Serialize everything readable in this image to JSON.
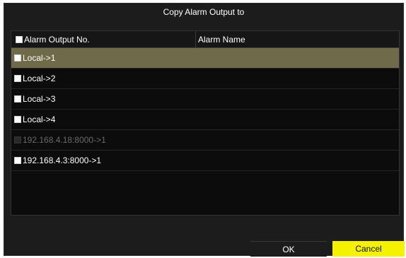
{
  "dialog": {
    "title": "Copy Alarm Output to"
  },
  "table": {
    "headers": {
      "col1": "Alarm Output No.",
      "col2": "Alarm Name"
    },
    "rows": [
      {
        "label": "Local->1",
        "selected": true,
        "enabled": true
      },
      {
        "label": "Local->2",
        "selected": false,
        "enabled": true
      },
      {
        "label": "Local->3",
        "selected": false,
        "enabled": true
      },
      {
        "label": "Local->4",
        "selected": false,
        "enabled": true
      },
      {
        "label": "192.168.4.18:8000->1",
        "selected": false,
        "enabled": false
      },
      {
        "label": "192.168.4.3:8000->1",
        "selected": false,
        "enabled": true
      }
    ]
  },
  "buttons": {
    "ok": "OK",
    "cancel": "Cancel"
  },
  "colors": {
    "selected_row": "#6f6b4a",
    "cancel_button": "#f4f200"
  }
}
